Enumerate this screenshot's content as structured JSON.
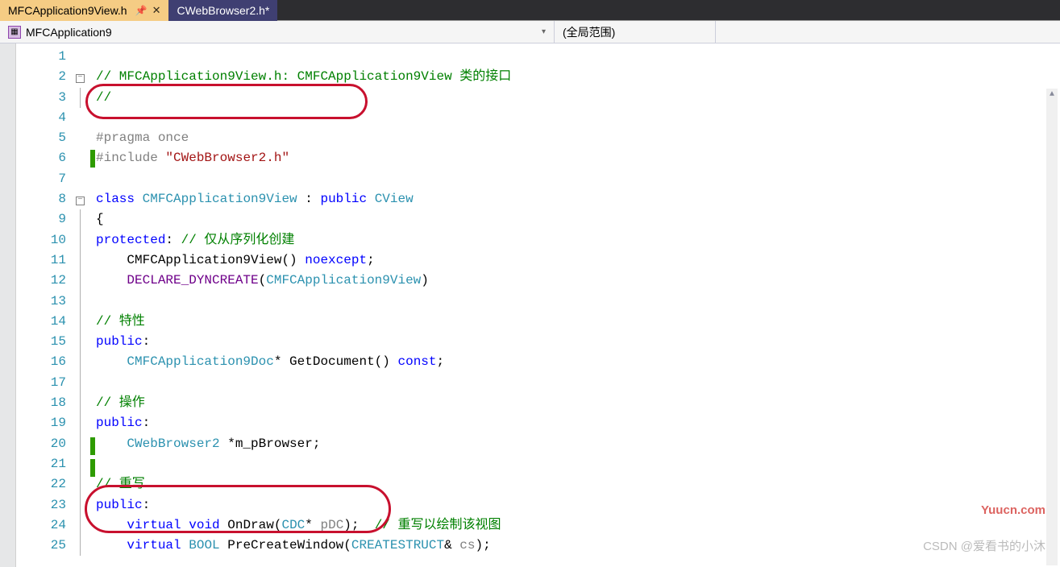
{
  "tabs": [
    {
      "label": "MFCApplication9View.h",
      "active": true,
      "pinned": true,
      "dirty": false
    },
    {
      "label": "CWebBrowser2.h*",
      "active": false,
      "pinned": false,
      "dirty": true
    }
  ],
  "nav": {
    "project": "MFCApplication9",
    "scope": "(全局范围)"
  },
  "watermarks": {
    "site": "Yuucn.com",
    "author": "CSDN @爱看书的小沐"
  },
  "code": {
    "lines": [
      {
        "n": 1,
        "fold": "",
        "change": false,
        "segments": []
      },
      {
        "n": 2,
        "fold": "⊟",
        "change": false,
        "segments": [
          {
            "t": "// MFCApplication9View.h: CMFCApplication9View 类的接口",
            "c": "c-comment"
          }
        ]
      },
      {
        "n": 3,
        "fold": "|",
        "change": false,
        "segments": [
          {
            "t": "//",
            "c": "c-comment"
          }
        ]
      },
      {
        "n": 4,
        "fold": "",
        "change": false,
        "segments": []
      },
      {
        "n": 5,
        "fold": "",
        "change": false,
        "segments": [
          {
            "t": "#pragma",
            "c": "c-pragma"
          },
          {
            "t": " ",
            "c": ""
          },
          {
            "t": "once",
            "c": "c-pragma"
          }
        ]
      },
      {
        "n": 6,
        "fold": "",
        "change": true,
        "segments": [
          {
            "t": "#include",
            "c": "c-pragma"
          },
          {
            "t": " ",
            "c": ""
          },
          {
            "t": "\"CWebBrowser2.h\"",
            "c": "c-string"
          }
        ]
      },
      {
        "n": 7,
        "fold": "",
        "change": false,
        "segments": []
      },
      {
        "n": 8,
        "fold": "⊟",
        "change": false,
        "segments": [
          {
            "t": "class",
            "c": "c-keyword"
          },
          {
            "t": " ",
            "c": ""
          },
          {
            "t": "CMFCApplication9View",
            "c": "c-type"
          },
          {
            "t": " : ",
            "c": ""
          },
          {
            "t": "public",
            "c": "c-keyword"
          },
          {
            "t": " ",
            "c": ""
          },
          {
            "t": "CView",
            "c": "c-type"
          }
        ]
      },
      {
        "n": 9,
        "fold": "|",
        "change": false,
        "segments": [
          {
            "t": "{",
            "c": "c-punct"
          }
        ]
      },
      {
        "n": 10,
        "fold": "|",
        "change": false,
        "segments": [
          {
            "t": "protected",
            "c": "c-keyword"
          },
          {
            "t": ": ",
            "c": "c-punct"
          },
          {
            "t": "// 仅从序列化创建",
            "c": "c-comment"
          }
        ]
      },
      {
        "n": 11,
        "fold": "|",
        "change": false,
        "segments": [
          {
            "t": "    CMFCApplication9View",
            "c": ""
          },
          {
            "t": "() ",
            "c": "c-punct"
          },
          {
            "t": "noexcept",
            "c": "c-keyword"
          },
          {
            "t": ";",
            "c": "c-punct"
          }
        ]
      },
      {
        "n": 12,
        "fold": "|",
        "change": false,
        "segments": [
          {
            "t": "    ",
            "c": ""
          },
          {
            "t": "DECLARE_DYNCREATE",
            "c": "c-macro"
          },
          {
            "t": "(",
            "c": "c-punct"
          },
          {
            "t": "CMFCApplication9View",
            "c": "c-type"
          },
          {
            "t": ")",
            "c": "c-punct"
          }
        ]
      },
      {
        "n": 13,
        "fold": "|",
        "change": false,
        "segments": []
      },
      {
        "n": 14,
        "fold": "|",
        "change": false,
        "segments": [
          {
            "t": "// 特性",
            "c": "c-comment"
          }
        ]
      },
      {
        "n": 15,
        "fold": "|",
        "change": false,
        "segments": [
          {
            "t": "public",
            "c": "c-keyword"
          },
          {
            "t": ":",
            "c": "c-punct"
          }
        ]
      },
      {
        "n": 16,
        "fold": "|",
        "change": false,
        "segments": [
          {
            "t": "    ",
            "c": ""
          },
          {
            "t": "CMFCApplication9Doc",
            "c": "c-type"
          },
          {
            "t": "* GetDocument",
            "c": ""
          },
          {
            "t": "() ",
            "c": "c-punct"
          },
          {
            "t": "const",
            "c": "c-keyword"
          },
          {
            "t": ";",
            "c": "c-punct"
          }
        ]
      },
      {
        "n": 17,
        "fold": "|",
        "change": false,
        "segments": []
      },
      {
        "n": 18,
        "fold": "|",
        "change": false,
        "segments": [
          {
            "t": "// 操作",
            "c": "c-comment"
          }
        ]
      },
      {
        "n": 19,
        "fold": "|",
        "change": false,
        "segments": [
          {
            "t": "public",
            "c": "c-keyword"
          },
          {
            "t": ":",
            "c": "c-punct"
          }
        ]
      },
      {
        "n": 20,
        "fold": "|",
        "change": true,
        "segments": [
          {
            "t": "    ",
            "c": ""
          },
          {
            "t": "CWebBrowser2",
            "c": "c-type"
          },
          {
            "t": " *m_pBrowser;",
            "c": "c-punct"
          }
        ]
      },
      {
        "n": 21,
        "fold": "|",
        "change": true,
        "segments": []
      },
      {
        "n": 22,
        "fold": "|",
        "change": false,
        "segments": [
          {
            "t": "// 重写",
            "c": "c-comment"
          }
        ]
      },
      {
        "n": 23,
        "fold": "|",
        "change": false,
        "segments": [
          {
            "t": "public",
            "c": "c-keyword"
          },
          {
            "t": ":",
            "c": "c-punct"
          }
        ]
      },
      {
        "n": 24,
        "fold": "|",
        "change": false,
        "segments": [
          {
            "t": "    ",
            "c": ""
          },
          {
            "t": "virtual",
            "c": "c-keyword"
          },
          {
            "t": " ",
            "c": ""
          },
          {
            "t": "void",
            "c": "c-keyword"
          },
          {
            "t": " OnDraw",
            "c": ""
          },
          {
            "t": "(",
            "c": "c-punct"
          },
          {
            "t": "CDC",
            "c": "c-type"
          },
          {
            "t": "* ",
            "c": ""
          },
          {
            "t": "pDC",
            "c": "c-param"
          },
          {
            "t": ");  ",
            "c": "c-punct"
          },
          {
            "t": "// 重写以绘制该视图",
            "c": "c-comment"
          }
        ]
      },
      {
        "n": 25,
        "fold": "|",
        "change": false,
        "segments": [
          {
            "t": "    ",
            "c": ""
          },
          {
            "t": "virtual",
            "c": "c-keyword"
          },
          {
            "t": " ",
            "c": ""
          },
          {
            "t": "BOOL",
            "c": "c-type"
          },
          {
            "t": " PreCreateWindow",
            "c": ""
          },
          {
            "t": "(",
            "c": "c-punct"
          },
          {
            "t": "CREATESTRUCT",
            "c": "c-type"
          },
          {
            "t": "& ",
            "c": ""
          },
          {
            "t": "cs",
            "c": "c-param"
          },
          {
            "t": ");",
            "c": "c-punct"
          }
        ]
      }
    ]
  }
}
